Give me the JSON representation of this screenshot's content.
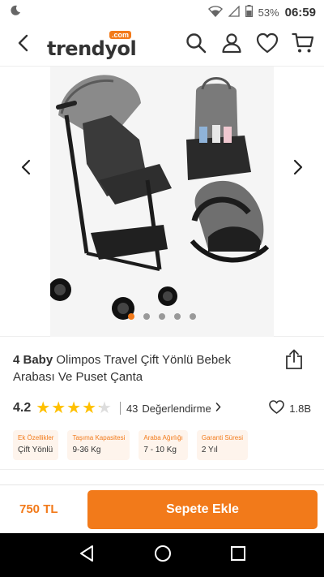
{
  "status_bar": {
    "battery": "53%",
    "time": "06:59"
  },
  "header": {
    "logo_text": "trendyol",
    "logo_badge": ".com",
    "icons": [
      "back-icon",
      "search-icon",
      "user-icon",
      "heart-icon",
      "cart-icon"
    ]
  },
  "gallery": {
    "total_images": 5,
    "active_index": 0
  },
  "product": {
    "brand": "4 Baby",
    "title": "Olimpos Travel Çift Yönlü Bebek Arabası Ve Puset Çanta",
    "rating": "4.2",
    "rating_value": 4.2,
    "rating_count": "43",
    "reviews_label": "Değerlendirme",
    "favorites": "1.8B"
  },
  "features": [
    {
      "label": "Ek Özellikler",
      "value": "Çift Yönlü"
    },
    {
      "label": "Taşıma Kapasitesi",
      "value": "9-36 Kg"
    },
    {
      "label": "Araba Ağırlığı",
      "value": "7 - 10 Kg"
    },
    {
      "label": "Garanti Süresi",
      "value": "2 Yıl"
    }
  ],
  "bottom_bar": {
    "price": "750 TL",
    "add_to_cart": "Sepete Ekle"
  },
  "colors": {
    "accent": "#f27a1a",
    "star": "#ffc000"
  }
}
